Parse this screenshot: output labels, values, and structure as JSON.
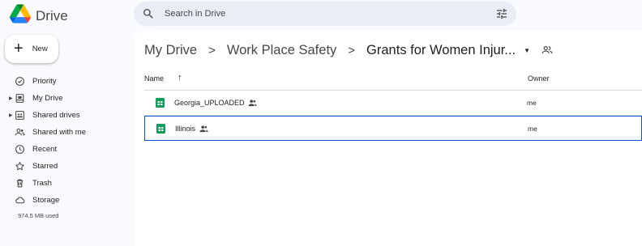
{
  "app": {
    "title": "Drive"
  },
  "search": {
    "placeholder": "Search in Drive",
    "value": ""
  },
  "new_button": {
    "label": "New"
  },
  "sidebar": {
    "items": [
      {
        "label": "Priority",
        "icon": "priority-icon",
        "expandable": false
      },
      {
        "label": "My Drive",
        "icon": "my-drive-icon",
        "expandable": true
      },
      {
        "label": "Shared drives",
        "icon": "shared-drives-icon",
        "expandable": true
      },
      {
        "label": "Shared with me",
        "icon": "shared-with-me-icon",
        "expandable": false
      },
      {
        "label": "Recent",
        "icon": "clock-icon",
        "expandable": false
      },
      {
        "label": "Starred",
        "icon": "star-icon",
        "expandable": false
      },
      {
        "label": "Trash",
        "icon": "trash-icon",
        "expandable": false
      },
      {
        "label": "Storage",
        "icon": "cloud-icon",
        "expandable": false
      }
    ],
    "storage_used": "974.5 MB used"
  },
  "breadcrumb": {
    "items": [
      "My Drive",
      "Work Place Safety",
      "Grants for Women Injur..."
    ],
    "separator": ">"
  },
  "columns": {
    "name": "Name",
    "owner": "Owner"
  },
  "files": [
    {
      "name": "Georgia_UPLOADED",
      "owner": "me",
      "type": "google-sheets",
      "shared": true,
      "selected": false
    },
    {
      "name": "Illinois",
      "owner": "me",
      "type": "google-sheets",
      "shared": true,
      "selected": true
    }
  ],
  "colors": {
    "background": "#f8fafd",
    "search_bg": "#e9eef6",
    "sheets_green": "#0f9d58",
    "selection_border": "#0b57d0"
  }
}
